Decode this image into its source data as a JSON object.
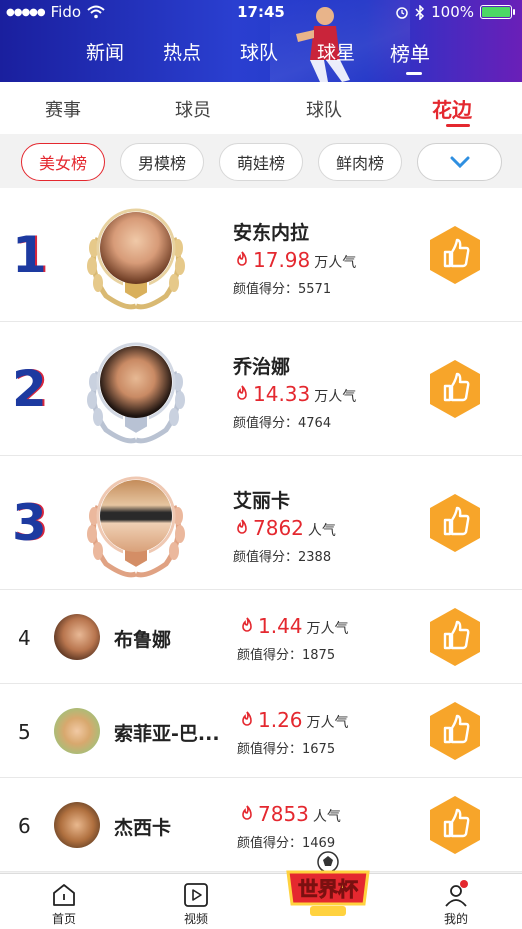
{
  "status": {
    "carrier": "Fido",
    "time": "17:45",
    "battery": "100%"
  },
  "top_nav": [
    {
      "label": "新闻",
      "active": false
    },
    {
      "label": "热点",
      "active": false
    },
    {
      "label": "球队",
      "active": false
    },
    {
      "label": "球星",
      "active": false
    },
    {
      "label": "榜单",
      "active": true
    }
  ],
  "sub_tabs": [
    {
      "label": "赛事",
      "active": false
    },
    {
      "label": "球员",
      "active": false
    },
    {
      "label": "球队",
      "active": false
    },
    {
      "label": "花边",
      "active": true
    }
  ],
  "filters": [
    {
      "label": "美女榜",
      "active": true
    },
    {
      "label": "男模榜",
      "active": false
    },
    {
      "label": "萌娃榜",
      "active": false
    },
    {
      "label": "鲜肉榜",
      "active": false
    }
  ],
  "score_label": "颜值得分：",
  "entries": [
    {
      "rank": "1",
      "name": "安东内拉",
      "popularity": "17.98",
      "unit": "万人气",
      "score": "5571",
      "medal": "gold"
    },
    {
      "rank": "2",
      "name": "乔治娜",
      "popularity": "14.33",
      "unit": "万人气",
      "score": "4764",
      "medal": "silver"
    },
    {
      "rank": "3",
      "name": "艾丽卡",
      "popularity": "7862",
      "unit": "人气",
      "score": "2388",
      "medal": "bronze"
    },
    {
      "rank": "4",
      "name": "布鲁娜",
      "popularity": "1.44",
      "unit": "万人气",
      "score": "1875"
    },
    {
      "rank": "5",
      "name": "索菲亚-巴...",
      "popularity": "1.26",
      "unit": "万人气",
      "score": "1675"
    },
    {
      "rank": "6",
      "name": "杰西卡",
      "popularity": "7853",
      "unit": "人气",
      "score": "1469"
    }
  ],
  "bottom_nav": [
    {
      "label": "首页",
      "icon": "home-icon"
    },
    {
      "label": "视频",
      "icon": "play-icon"
    },
    {
      "label": "我的",
      "icon": "profile-icon"
    }
  ],
  "worldcup_badge": "世界杯",
  "colors": {
    "accent": "#e4282f",
    "header": "#2236c8",
    "like": "#f7a52a"
  }
}
